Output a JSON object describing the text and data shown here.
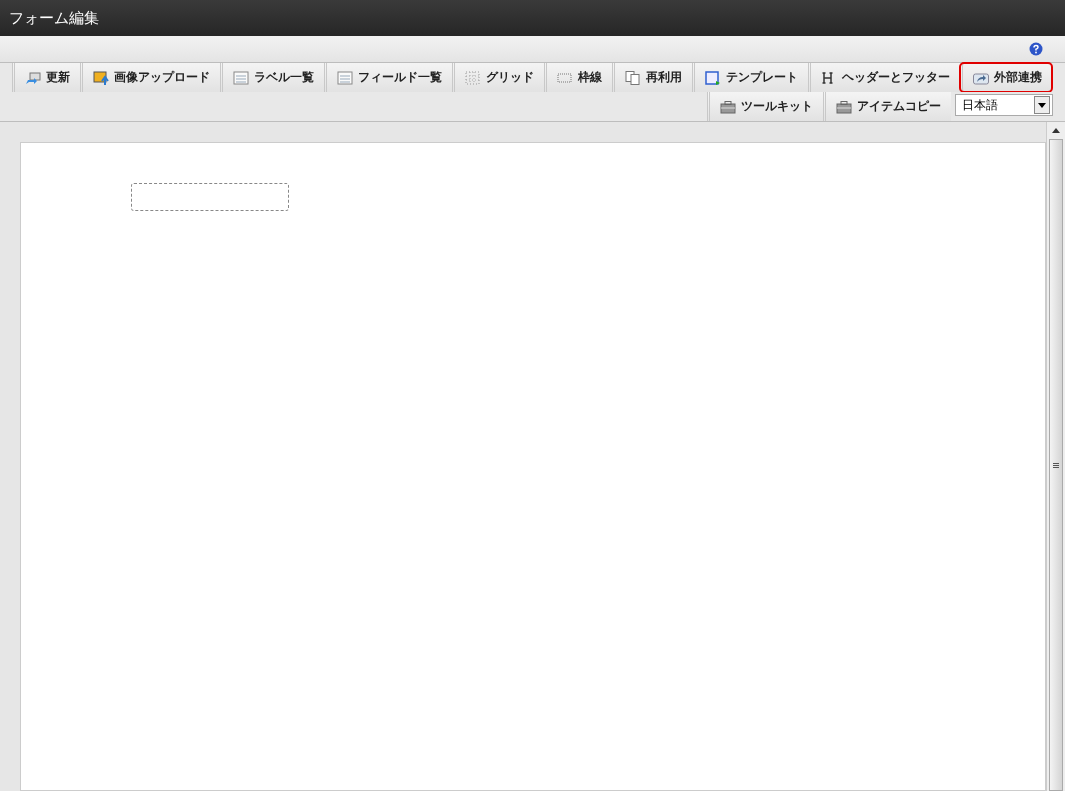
{
  "window": {
    "title": "フォーム編集"
  },
  "toolbar": [
    {
      "label": "更新",
      "kind": "refresh",
      "highlighted": false
    },
    {
      "label": "画像アップロード",
      "kind": "image",
      "highlighted": false
    },
    {
      "label": "ラベル一覧",
      "kind": "list",
      "highlighted": false
    },
    {
      "label": "フィールド一覧",
      "kind": "list",
      "highlighted": false
    },
    {
      "label": "グリッド",
      "kind": "grid",
      "highlighted": false
    },
    {
      "label": "枠線",
      "kind": "border",
      "highlighted": false
    },
    {
      "label": "再利用",
      "kind": "copy",
      "highlighted": false
    },
    {
      "label": "テンプレート",
      "kind": "template",
      "highlighted": false
    },
    {
      "label": "ヘッダーとフッター",
      "kind": "header",
      "highlighted": false
    },
    {
      "label": "外部連携",
      "kind": "share",
      "highlighted": true
    }
  ],
  "toolbar_row2": [
    {
      "label": "ツールキット",
      "kind": "toolbox"
    },
    {
      "label": "アイテムコピー",
      "kind": "toolbox"
    }
  ],
  "language": {
    "value": "日本語"
  }
}
